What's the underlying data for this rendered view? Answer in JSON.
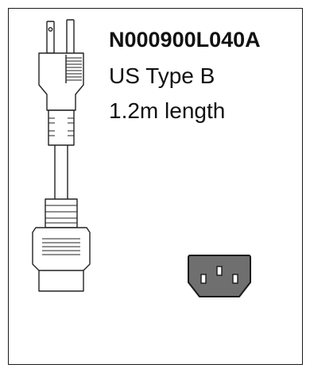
{
  "product": {
    "part_number": "N000900L040A",
    "plug_type": "US Type B",
    "length": "1.2m length"
  },
  "icons": {
    "cable": "power-cable-nema-5-15p-to-c13-icon",
    "socket": "iec-c13-socket-icon"
  },
  "colors": {
    "border": "#1a1a1a",
    "socket_fill": "#6f6f6f",
    "line": "#222222"
  }
}
